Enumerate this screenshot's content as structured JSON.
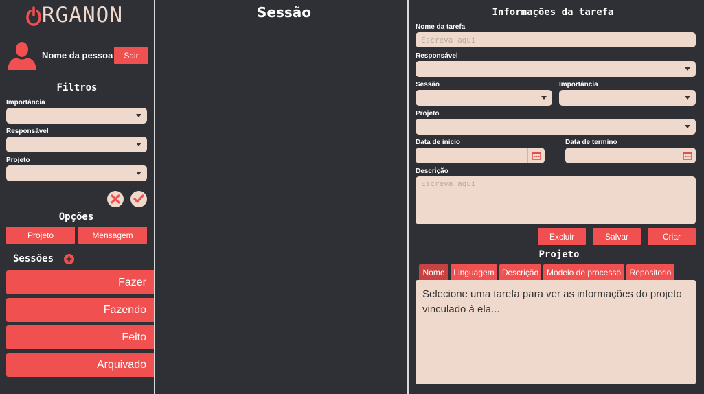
{
  "app": {
    "logo_text": "RGANON"
  },
  "user": {
    "name": "Nome da pessoa",
    "logout_label": "Sair"
  },
  "filters": {
    "title": "Filtros",
    "importance_label": "Importância",
    "responsible_label": "Responsável",
    "project_label": "Projeto"
  },
  "options": {
    "title": "Opções",
    "project_button": "Projeto",
    "message_button": "Mensagem"
  },
  "sessions": {
    "title": "Sessões",
    "items": [
      "Fazer",
      "Fazendo",
      "Feito",
      "Arquivado"
    ]
  },
  "session_panel": {
    "title": "Sessão"
  },
  "task_info": {
    "title": "Informações da tarefa",
    "task_name_label": "Nome da tarefa",
    "task_name_placeholder": "Escreva aqui",
    "responsible_label": "Responsável",
    "session_label": "Sessão",
    "importance_label": "Importância",
    "project_label": "Projeto",
    "start_date_label": "Data de inicio",
    "end_date_label": "Data de termino",
    "description_label": "Descrição",
    "description_placeholder": "Escreva aqui",
    "delete_button": "Excluir",
    "save_button": "Salvar",
    "create_button": "Criar"
  },
  "project": {
    "title": "Projeto",
    "tabs": [
      "Nome",
      "Linguagem",
      "Descrição",
      "Modelo de processo",
      "Repositorio"
    ],
    "active_tab": "Nome",
    "content": "Selecione uma tarefa para ver as informações do projeto vinculado à ela..."
  },
  "colors": {
    "accent": "#f0504f",
    "field_bg": "#efd9cc",
    "page_bg": "#2f3035"
  }
}
